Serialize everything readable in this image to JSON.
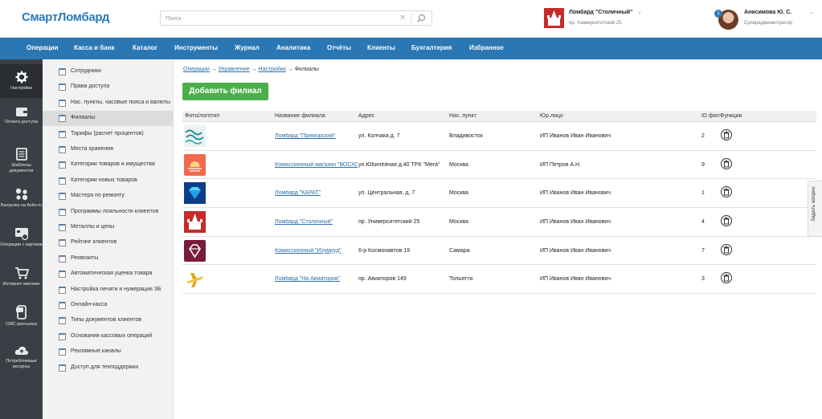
{
  "app": {
    "logo_text": "СмартЛомбард"
  },
  "search": {
    "placeholder": "Поиск"
  },
  "branch": {
    "name": "Ломбард \"Столичный\"",
    "address": "пр. Университетский 25"
  },
  "user": {
    "name": "Анисимова Ю. С.",
    "role": "Суперадминистратор",
    "notifications": "1"
  },
  "nav": [
    "Операции",
    "Касса и банк",
    "Каталог",
    "Инструменты",
    "Журнал",
    "Аналитика",
    "Отчёты",
    "Клиенты",
    "Бухгалтерия",
    "Избранное"
  ],
  "rail": [
    {
      "label": "Настройки",
      "icon": "gear-icon",
      "active": true
    },
    {
      "label": "Оплата доступа",
      "icon": "wallet-icon"
    },
    {
      "label": "Шаблоны документов",
      "icon": "document-icon"
    },
    {
      "label": "Выгрузка на Avito.ru",
      "icon": "avito-icon"
    },
    {
      "label": "Операции с картами",
      "icon": "card-icon"
    },
    {
      "label": "Интернет-магазин",
      "icon": "cart-icon"
    },
    {
      "label": "СМС-рассылка",
      "icon": "sms-icon"
    },
    {
      "label": "Потребляемые ресурсы",
      "icon": "cloud-icon"
    }
  ],
  "subnav": [
    "Сотрудники",
    "Права доступа",
    "Нас. пункты, часовые пояса и валюты",
    "Филиалы",
    "Тарифы (расчет процентов)",
    "Места хранения",
    "Категории товаров и имущества",
    "Категории новых товаров",
    "Мастера по ремонту",
    "Программы лояльности клиентов",
    "Металлы и цены",
    "Рейтинг клиентов",
    "Реквизиты",
    "Автоматическая уценка товара",
    "Настройка печати и нумерации ЗБ",
    "Онлайн-касса",
    "Типы документов клиентов",
    "Основания кассовых операций",
    "Рекламные каналы",
    "Доступ для техподдержки"
  ],
  "subnav_active": "Филиалы",
  "breadcrumb": {
    "items": [
      "Операции",
      "Управление",
      "Настройки"
    ],
    "current": "Филиалы",
    "separator": "→"
  },
  "add_button": "Добавить филиал",
  "table": {
    "headers": [
      "Фото/логотип",
      "Название филиала",
      "Адрес",
      "Нас. пункт",
      "Юр.лицо",
      "ID фил",
      "Функции"
    ],
    "rows": [
      {
        "logo": "wave-logo",
        "name": "Ломбард \"Приморский\"",
        "address": "ул. Колчака д. 7",
        "city": "Владивосток",
        "entity": "ИП Иванов Иван Иванович",
        "id": "2"
      },
      {
        "logo": "sunset-logo",
        "name": "Комиссионный магазин \"ВОСХОД\"",
        "address": "ул.Юбилейная д.40 ТРК \"Мега\"",
        "city": "Москва",
        "entity": "ИП Петров А.Н.",
        "id": "9"
      },
      {
        "logo": "diamond-logo",
        "name": "Ломбард \"КАРАТ\"",
        "address": "ул. Центральная, д. 7",
        "city": "Москва",
        "entity": "ИП Иванов Иван Иванович",
        "id": "1"
      },
      {
        "logo": "kremlin-logo",
        "name": "Ломбард \"Столичный\"",
        "address": "пр. Университетский 25",
        "city": "Москва",
        "entity": "ИП Иванов Иван Иванович",
        "id": "4"
      },
      {
        "logo": "emerald-logo",
        "name": "Комиссионный \"Изумруд\"",
        "address": "6-р Космонавтов 19",
        "city": "Самара",
        "entity": "ИП Иванов Иван Иванович",
        "id": "7"
      },
      {
        "logo": "plane-logo",
        "name": "Ломбард \"На Авиаторов\"",
        "address": "пр. Авиаторов 149",
        "city": "Тольятти",
        "entity": "ИП Иванов Иван Иванович",
        "id": "3"
      }
    ]
  },
  "feedback": "Задать вопрос"
}
